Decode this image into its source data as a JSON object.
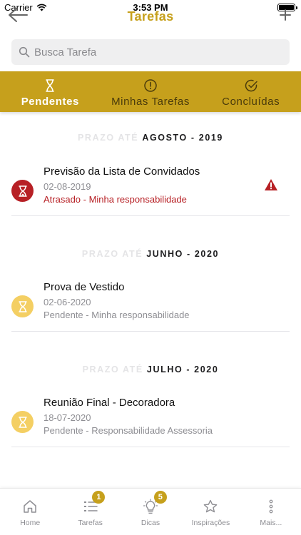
{
  "status_bar": {
    "carrier": "Carrier",
    "time": "3:53 PM"
  },
  "nav": {
    "title": "Tarefas",
    "back_icon": "arrow-left-icon",
    "add_icon": "plus-icon"
  },
  "search": {
    "placeholder": "Busca Tarefa",
    "value": ""
  },
  "tabs": [
    {
      "label": "Pendentes",
      "icon": "hourglass-icon",
      "active": true
    },
    {
      "label": "Minhas Tarefas",
      "icon": "alert-circle-icon",
      "active": false
    },
    {
      "label": "Concluídas",
      "icon": "check-circle-icon",
      "active": false
    }
  ],
  "sections": [
    {
      "prefix": "PRAZO ATÉ",
      "month": "AGOSTO - 2019",
      "tasks": [
        {
          "title": "Previsão da Lista de Convidados",
          "date": "02-08-2019",
          "status": "Atrasado - Minha responsabilidade",
          "state": "late"
        }
      ]
    },
    {
      "prefix": "PRAZO ATÉ",
      "month": "JUNHO - 2020",
      "tasks": [
        {
          "title": "Prova de Vestido",
          "date": "02-06-2020",
          "status": "Pendente - Minha responsabilidade",
          "state": "pending"
        }
      ]
    },
    {
      "prefix": "PRAZO ATÉ",
      "month": "JULHO - 2020",
      "tasks": [
        {
          "title": "Reunião Final - Decoradora",
          "date": "18-07-2020",
          "status": "Pendente - Responsabilidade Assessoria",
          "state": "pending"
        }
      ]
    }
  ],
  "tab_bar": [
    {
      "label": "Home",
      "icon": "home-icon",
      "badge": ""
    },
    {
      "label": "Tarefas",
      "icon": "task-list-icon",
      "badge": "1"
    },
    {
      "label": "Dicas",
      "icon": "lightbulb-icon",
      "badge": "5"
    },
    {
      "label": "Inspirações",
      "icon": "star-icon",
      "badge": ""
    },
    {
      "label": "Mais...",
      "icon": "more-icon",
      "badge": ""
    }
  ],
  "colors": {
    "brand": "#c6a01c",
    "late": "#b72025",
    "pending": "#f4cf63"
  }
}
